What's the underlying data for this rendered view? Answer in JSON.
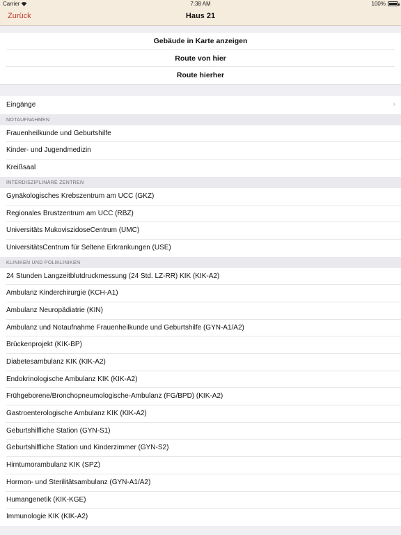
{
  "status": {
    "carrier": "Carrier",
    "time": "7:38 AM",
    "battery": "100%"
  },
  "nav": {
    "back_label": "Zurück",
    "title": "Haus 21",
    "accent_color": "#c0392b",
    "bar_color": "#f6ecdd"
  },
  "actions": [
    "Gebäude in Karte anzeigen",
    "Route von hier",
    "Route hierher"
  ],
  "entrances_label": "Eingänge",
  "sections": [
    {
      "header": "NOTAUFNAHMEN",
      "items": [
        "Frauenheilkunde und Geburtshilfe",
        "Kinder- und Jugendmedizin",
        "Kreißsaal"
      ]
    },
    {
      "header": "INTERDISZIPLINÄRE ZENTREN",
      "items": [
        "Gynäkologisches Krebszentrum am UCC (GKZ)",
        "Regionales Brustzentrum am UCC (RBZ)",
        "Universitäts MukoviszidoseCentrum (UMC)",
        "UniversitätsCentrum für Seltene Erkrankungen (USE)"
      ]
    },
    {
      "header": "KLINIKEN UND POLIKLINIKEN",
      "items": [
        "24 Stunden Langzeitblutdruckmessung (24 Std. LZ-RR) KIK (KIK-A2)",
        "Ambulanz Kinderchirurgie (KCH-A1)",
        "Ambulanz Neuropädiatrie (KIN)",
        "Ambulanz und Notaufnahme Frauenheilkunde und Geburtshilfe (GYN-A1/A2)",
        "Brückenprojekt (KIK-BP)",
        "Diabetesambulanz KIK (KIK-A2)",
        "Endokrinologische Ambulanz KIK (KIK-A2)",
        "Frühgeborene/Bronchopneumologische-Ambulanz (FG/BPD) (KIK-A2)",
        "Gastroenterologische Ambulanz KIK (KIK-A2)",
        "Geburtshilfliche Station (GYN-S1)",
        "Geburtshilfliche Station und Kinderzimmer (GYN-S2)",
        "Hirntumorambulanz KIK (SPZ)",
        "Hormon- und Sterilitätsambulanz (GYN-A1/A2)",
        "Humangenetik (KIK-KGE)",
        "Immunologie KIK (KIK-A2)"
      ]
    }
  ]
}
